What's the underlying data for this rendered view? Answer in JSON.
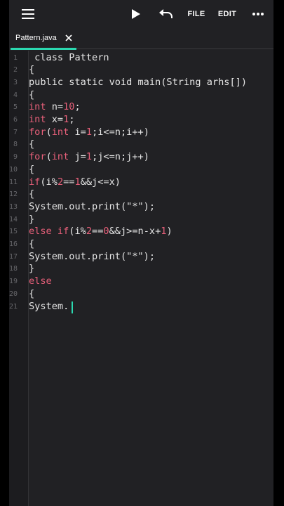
{
  "toolbar": {
    "menu_icon": "hamburger-menu-icon",
    "run_icon": "play-icon",
    "undo_icon": "undo-icon",
    "file_label": "FILE",
    "edit_label": "EDIT",
    "more_icon": "more-dots-icon"
  },
  "tab": {
    "label": "Pattern.java",
    "close_icon": "close-icon",
    "accent_color": "#2bd9b0"
  },
  "colors": {
    "background": "#212124",
    "text": "#e6e6e6",
    "keyword": "#e8607a",
    "number": "#e8607a",
    "string": "#e6e6e6",
    "line_number": "#66666a",
    "cursor": "#2bd9b0"
  },
  "editor": {
    "lines": [
      {
        "n": "1",
        "tokens": [
          {
            "t": " class Pattern"
          }
        ]
      },
      {
        "n": "2",
        "tokens": [
          {
            "t": "{"
          }
        ]
      },
      {
        "n": "3",
        "tokens": [
          {
            "t": "public static void main(String arhs[])"
          }
        ]
      },
      {
        "n": "4",
        "tokens": [
          {
            "t": "{"
          }
        ]
      },
      {
        "n": "5",
        "tokens": [
          {
            "t": "int",
            "k": 1
          },
          {
            "t": " n="
          },
          {
            "t": "10",
            "k": 2
          },
          {
            "t": ";"
          }
        ]
      },
      {
        "n": "6",
        "tokens": [
          {
            "t": "int",
            "k": 1
          },
          {
            "t": " x="
          },
          {
            "t": "1",
            "k": 2
          },
          {
            "t": ";"
          }
        ]
      },
      {
        "n": "7",
        "tokens": [
          {
            "t": "for",
            "k": 1
          },
          {
            "t": "("
          },
          {
            "t": "int",
            "k": 1
          },
          {
            "t": " i="
          },
          {
            "t": "1",
            "k": 2
          },
          {
            "t": ";i<=n;i++)"
          }
        ]
      },
      {
        "n": "8",
        "tokens": [
          {
            "t": "{"
          }
        ]
      },
      {
        "n": "9",
        "tokens": [
          {
            "t": "for",
            "k": 1
          },
          {
            "t": "("
          },
          {
            "t": "int",
            "k": 1
          },
          {
            "t": " j="
          },
          {
            "t": "1",
            "k": 2
          },
          {
            "t": ";j<=n;j++)"
          }
        ]
      },
      {
        "n": "10",
        "tokens": [
          {
            "t": "{"
          }
        ]
      },
      {
        "n": "11",
        "tokens": [
          {
            "t": "if",
            "k": 1
          },
          {
            "t": "(i%"
          },
          {
            "t": "2",
            "k": 2
          },
          {
            "t": "=="
          },
          {
            "t": "1",
            "k": 2
          },
          {
            "t": "&&j<=x)"
          }
        ]
      },
      {
        "n": "12",
        "tokens": [
          {
            "t": "{"
          }
        ]
      },
      {
        "n": "13",
        "tokens": [
          {
            "t": "System.out.print(\"*\");"
          }
        ]
      },
      {
        "n": "14",
        "tokens": [
          {
            "t": "}"
          }
        ]
      },
      {
        "n": "15",
        "tokens": [
          {
            "t": "else if",
            "k": 1
          },
          {
            "t": "(i%"
          },
          {
            "t": "2",
            "k": 2
          },
          {
            "t": "=="
          },
          {
            "t": "0",
            "k": 2
          },
          {
            "t": "&&j>=n-x+"
          },
          {
            "t": "1",
            "k": 2
          },
          {
            "t": ")"
          }
        ]
      },
      {
        "n": "16",
        "tokens": [
          {
            "t": "{"
          }
        ]
      },
      {
        "n": "17",
        "tokens": [
          {
            "t": "System.out.print(\"*\");"
          }
        ]
      },
      {
        "n": "18",
        "tokens": [
          {
            "t": "}"
          }
        ]
      },
      {
        "n": "19",
        "tokens": [
          {
            "t": "else",
            "k": 1
          }
        ]
      },
      {
        "n": "20",
        "tokens": [
          {
            "t": "{"
          }
        ]
      },
      {
        "n": "21",
        "tokens": [
          {
            "t": "System."
          }
        ]
      }
    ]
  }
}
